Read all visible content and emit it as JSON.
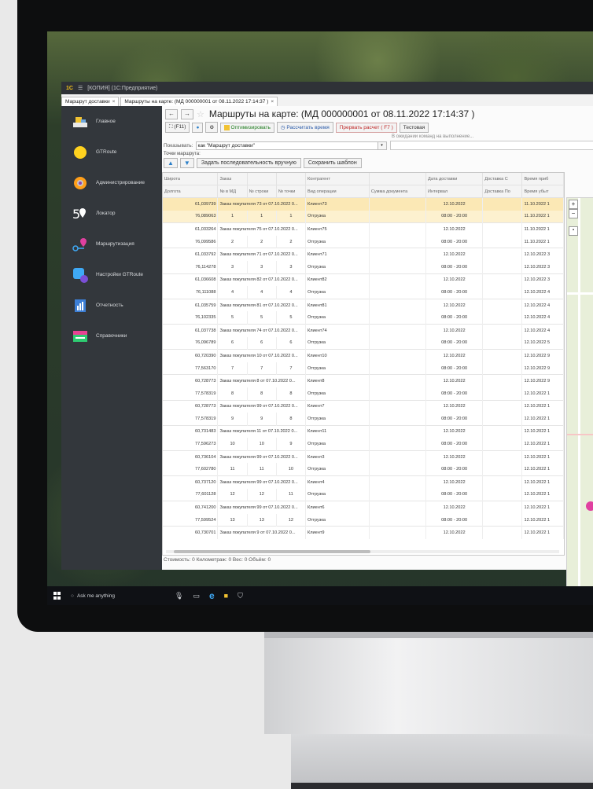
{
  "window": {
    "title": "[КОПИЯ]  (1С:Предприятие)",
    "logo": "1С"
  },
  "tabs": [
    {
      "label": "Маршрут доставки"
    },
    {
      "label": "Маршруты на карте:  (МД 000000001 от 08.11.2022 17:14:37 )"
    }
  ],
  "sidebar": {
    "items": [
      {
        "label": "Главное",
        "icon": "dashboard-icon"
      },
      {
        "label": "GTRoute",
        "icon": "yellow-circle-icon"
      },
      {
        "label": "Администрирование",
        "icon": "gear-icon"
      },
      {
        "label": "Локатор",
        "icon": "locator-icon"
      },
      {
        "label": "Маршрутизация",
        "icon": "route-icon"
      },
      {
        "label": "Настройки GTRoute",
        "icon": "settings-puzzle-icon"
      },
      {
        "label": "Отчетность",
        "icon": "report-icon"
      },
      {
        "label": "Справочники",
        "icon": "book-icon"
      }
    ]
  },
  "document": {
    "title": "Маршруты на карте:  (МД 000000001 от 08.11.2022 17:14:37 )"
  },
  "toolbar": {
    "f11": "(F11)",
    "optimize": "Оптимизировать",
    "calc_time": "Рассчитать время",
    "abort": "Прервать расчет ( F7 )",
    "test": "Тестовая"
  },
  "waiting_text": "В ожидании команд на выполнение...",
  "show": {
    "label": "Показывать:",
    "value": "как \"Маршрут доставки\""
  },
  "points": {
    "label": "Точки маршрута:",
    "manual": "Задать последовательность вручную",
    "save": "Сохранить шаблон"
  },
  "table": {
    "header1": [
      "Широта",
      "Заказ",
      "",
      "",
      "Контрагент",
      "",
      "Дата доставки",
      "Доставка С",
      "Время приб"
    ],
    "header2": [
      "Долгота",
      "№ в МД",
      "№ строки",
      "№ точки",
      "Вид операции",
      "Сумма документа",
      "Интервал",
      "Доставка По",
      "Время убыт"
    ],
    "groups": [
      {
        "lat": "61,039739",
        "lon": "76,089063",
        "order": "Заказ покупателя 73 от 07.10.2022 0...",
        "n_md": "1",
        "n_row": "1",
        "n_pt": "1",
        "client": "Клиент73",
        "op": "Отгрузка",
        "date": "12.10.2022",
        "interval": "08:00 - 20:00",
        "arr": "11.10.2022 1",
        "dep": "11.10.2022 1"
      },
      {
        "lat": "61,033264",
        "lon": "76,099586",
        "order": "Заказ покупателя 75 от 07.10.2022 0...",
        "n_md": "2",
        "n_row": "2",
        "n_pt": "2",
        "client": "Клиент75",
        "op": "Отгрузка",
        "date": "12.10.2022",
        "interval": "08:00 - 20:00",
        "arr": "11.10.2022 1",
        "dep": "11.10.2022 1"
      },
      {
        "lat": "61,033792",
        "lon": "76,114278",
        "order": "Заказ покупателя 71 от 07.10.2022 0...",
        "n_md": "3",
        "n_row": "3",
        "n_pt": "3",
        "client": "Клиент71",
        "op": "Отгрузка",
        "date": "12.10.2022",
        "interval": "08:00 - 20:00",
        "arr": "12.10.2022 3",
        "dep": "12.10.2022 3"
      },
      {
        "lat": "61,036608",
        "lon": "76,111088",
        "order": "Заказ покупателя 82 от 07.10.2022 0...",
        "n_md": "4",
        "n_row": "4",
        "n_pt": "4",
        "client": "Клиент82",
        "op": "Отгрузка",
        "date": "12.10.2022",
        "interval": "08:00 - 20:00",
        "arr": "12.10.2022 3",
        "dep": "12.10.2022 4"
      },
      {
        "lat": "61,035759",
        "lon": "76,102335",
        "order": "Заказ покупателя 81 от 07.10.2022 0...",
        "n_md": "5",
        "n_row": "5",
        "n_pt": "5",
        "client": "Клиент81",
        "op": "Отгрузка",
        "date": "12.10.2022",
        "interval": "08:00 - 20:00",
        "arr": "12.10.2022 4",
        "dep": "12.10.2022 4"
      },
      {
        "lat": "61,037738",
        "lon": "76,096789",
        "order": "Заказ покупателя 74 от 07.10.2022 0...",
        "n_md": "6",
        "n_row": "6",
        "n_pt": "6",
        "client": "Клиент74",
        "op": "Отгрузка",
        "date": "12.10.2022",
        "interval": "08:00 - 20:00",
        "arr": "12.10.2022 4",
        "dep": "12.10.2022 5"
      },
      {
        "lat": "60,720390",
        "lon": "77,563170",
        "order": "Заказ покупателя 10 от 07.10.2022 0...",
        "n_md": "7",
        "n_row": "7",
        "n_pt": "7",
        "client": "Клиент10",
        "op": "Отгрузка",
        "date": "12.10.2022",
        "interval": "08:00 - 20:00",
        "arr": "12.10.2022 9",
        "dep": "12.10.2022 9"
      },
      {
        "lat": "60,728773",
        "lon": "77,578319",
        "order": "Заказ покупателя 8 от 07.10.2022 0...",
        "n_md": "8",
        "n_row": "8",
        "n_pt": "8",
        "client": "Клиент8",
        "op": "Отгрузка",
        "date": "12.10.2022",
        "interval": "08:00 - 20:00",
        "arr": "12.10.2022 9",
        "dep": "12.10.2022 1"
      },
      {
        "lat": "60,728773",
        "lon": "77,578319",
        "order": "Заказ покупателя 99 от 07.10.2022 0...",
        "n_md": "9",
        "n_row": "9",
        "n_pt": "8",
        "client": "Клиент7",
        "op": "Отгрузка",
        "date": "12.10.2022",
        "interval": "08:00 - 20:00",
        "arr": "12.10.2022 1",
        "dep": "12.10.2022 1"
      },
      {
        "lat": "60,731483",
        "lon": "77,596273",
        "order": "Заказ покупателя 11 от 07.10.2022 0...",
        "n_md": "10",
        "n_row": "10",
        "n_pt": "9",
        "client": "Клиент11",
        "op": "Отгрузка",
        "date": "12.10.2022",
        "interval": "08:00 - 20:00",
        "arr": "12.10.2022 1",
        "dep": "12.10.2022 1"
      },
      {
        "lat": "60,736104",
        "lon": "77,602780",
        "order": "Заказ покупателя 99 от 07.10.2022 0...",
        "n_md": "11",
        "n_row": "11",
        "n_pt": "10",
        "client": "Клиент3",
        "op": "Отгрузка",
        "date": "12.10.2022",
        "interval": "08:00 - 20:00",
        "arr": "12.10.2022 1",
        "dep": "12.10.2022 1"
      },
      {
        "lat": "60,737120",
        "lon": "77,601128",
        "order": "Заказ покупателя 99 от 07.10.2022 0...",
        "n_md": "12",
        "n_row": "12",
        "n_pt": "11",
        "client": "Клиент4",
        "op": "Отгрузка",
        "date": "12.10.2022",
        "interval": "08:00 - 20:00",
        "arr": "12.10.2022 1",
        "dep": "12.10.2022 1"
      },
      {
        "lat": "60,741200",
        "lon": "77,599524",
        "order": "Заказ покупателя 99 от 07.10.2022 0...",
        "n_md": "13",
        "n_row": "13",
        "n_pt": "12",
        "client": "Клиент6",
        "op": "Отгрузка",
        "date": "12.10.2022",
        "interval": "08:00 - 20:00",
        "arr": "12.10.2022 1",
        "dep": "12.10.2022 1"
      },
      {
        "lat": "60,730701",
        "order": "Заказ покупателя 9 от 07.10.2022 0...",
        "client": "Клиент9",
        "date": "12.10.2022",
        "arr": "12.10.2022 1"
      }
    ]
  },
  "footer": "Стоимость: 0   Километраж: 0   Вес: 0   Объём: 0",
  "map": {
    "zoom_in": "+",
    "zoom_out": "−"
  },
  "taskbar": {
    "search": "Ask me anything"
  }
}
